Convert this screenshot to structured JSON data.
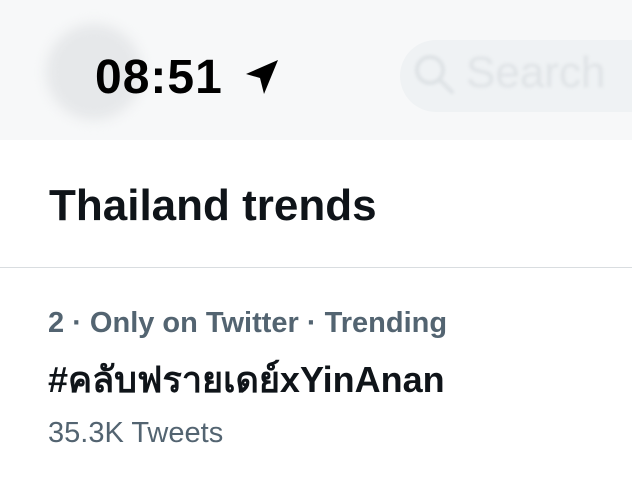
{
  "status_bar": {
    "time": "08:51",
    "location_icon": "location-arrow-icon"
  },
  "header": {
    "search_placeholder": "Search"
  },
  "section": {
    "title": "Thailand trends"
  },
  "trends": [
    {
      "rank": "2",
      "separator": " · ",
      "context": "Only on Twitter",
      "category": "Trending",
      "name": "#คลับฟรายเดย์xYinAnan",
      "count": "35.3K Tweets"
    }
  ],
  "colors": {
    "primary_text": "#0f1419",
    "secondary_text": "#536471",
    "divider": "#d9dde0"
  }
}
